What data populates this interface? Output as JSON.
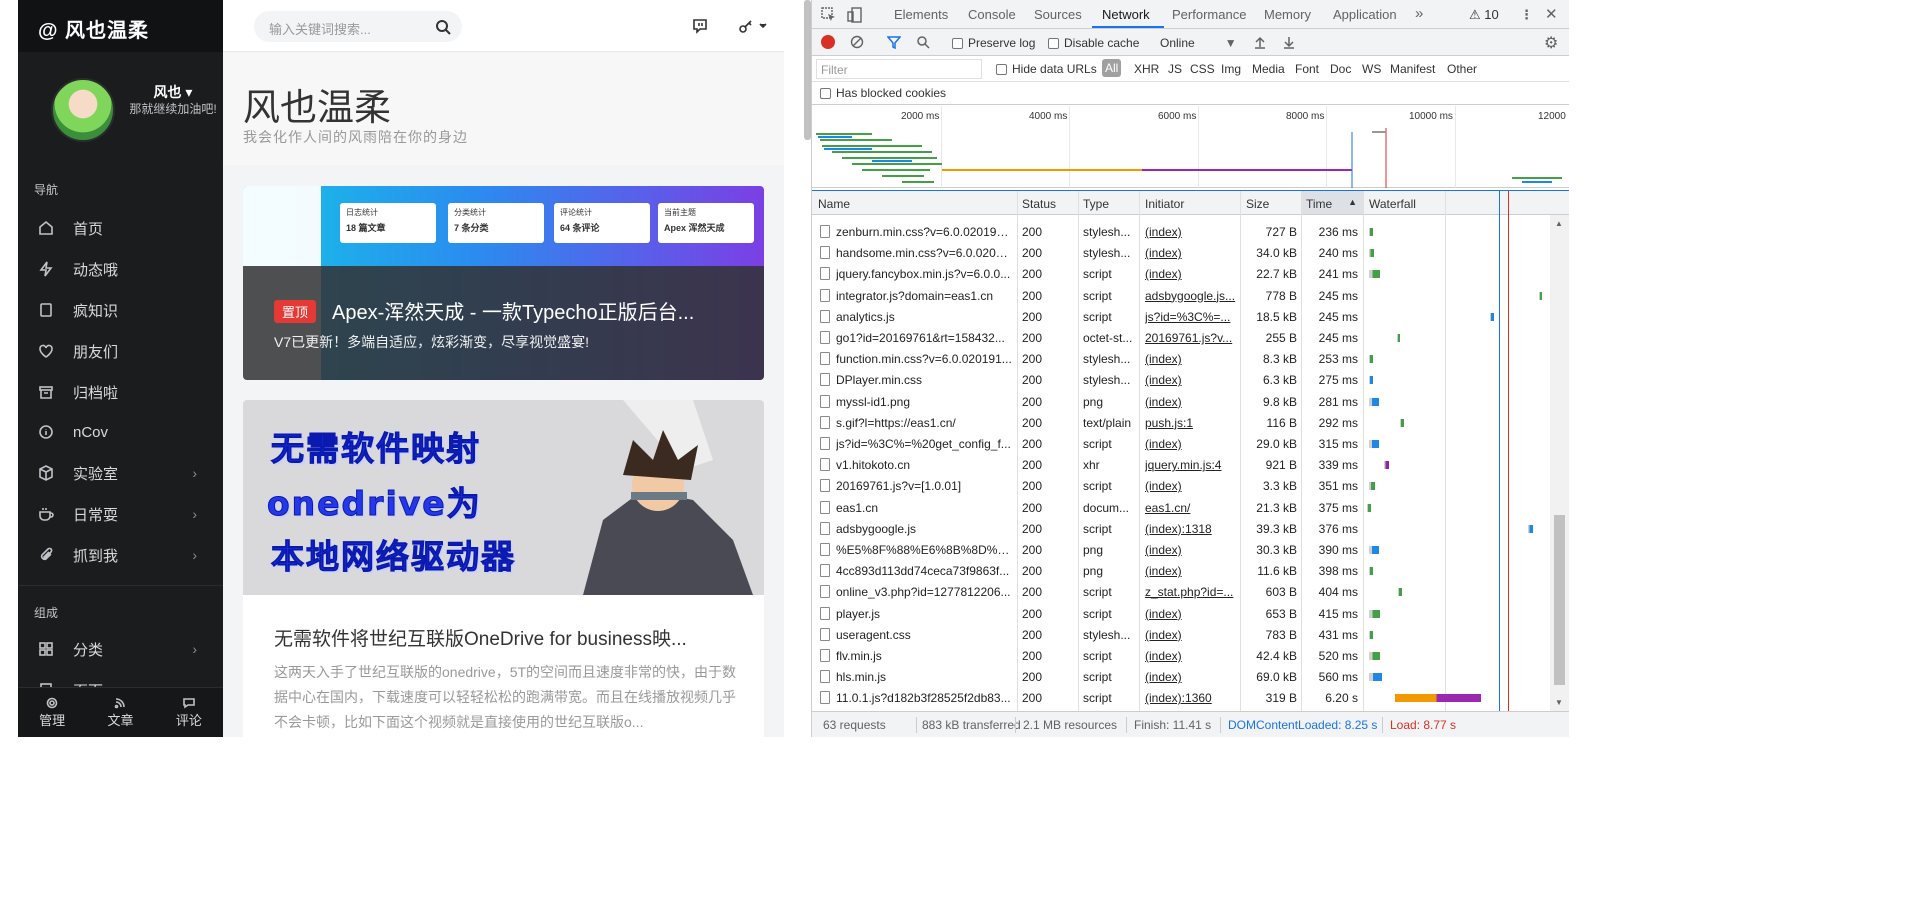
{
  "site": {
    "logo": "@ 风也温柔",
    "user": {
      "name": "风也 ▾",
      "motto": "那就继续加油吧!"
    },
    "nav_section": "导航",
    "nav": [
      "首页",
      "动态哦",
      "疯知识",
      "朋友们",
      "归档啦",
      "nCov",
      "实验室",
      "日常耍",
      "抓到我"
    ],
    "group_section": "组成",
    "group": [
      "分类",
      "页面"
    ],
    "footer": [
      "管理",
      "文章",
      "评论"
    ],
    "search_placeholder": "输入关键词搜索...",
    "hero_title": "风也温柔",
    "hero_subtitle": "我会化作人间的风雨陪在你的身边",
    "post1": {
      "pin": "置顶",
      "title": "Apex-浑然天成 - 一款Typecho正版后台...",
      "desc": "V7已更新！多端自适应，炫彩渐变，尽享视觉盛宴!",
      "stats": [
        "18 篇文章",
        "7 条分类",
        "64 条评论",
        "Apex 浑然天成"
      ]
    },
    "post2": {
      "banner": [
        "无需软件映射",
        "onedrive为",
        "本地网络驱动器"
      ],
      "title": "无需软件将世纪互联版OneDrive for business映...",
      "body": "这两天入手了世纪互联版的onedrive，5T的空间而且速度非常的快，由于数据中心在国内，下载速度可以轻轻松松的跑满带宽。而且在线播放视频几乎不会卡顿，比如下面这个视频就是直接使用的世纪互联版o..."
    }
  },
  "devtools": {
    "tabs": [
      "Elements",
      "Console",
      "Sources",
      "Network",
      "Performance",
      "Memory",
      "Application"
    ],
    "more": "»",
    "warnings": "⚠ 10",
    "preserve_log": "Preserve log",
    "disable_cache": "Disable cache",
    "throttle": "Online",
    "filter_placeholder": "Filter",
    "hide_data_urls": "Hide data URLs",
    "filter_types": [
      "All",
      "XHR",
      "JS",
      "CSS",
      "Img",
      "Media",
      "Font",
      "Doc",
      "WS",
      "Manifest",
      "Other"
    ],
    "has_blocked": "Has blocked cookies",
    "overview_ticks": [
      "2000 ms",
      "4000 ms",
      "6000 ms",
      "8000 ms",
      "10000 ms",
      "12000"
    ],
    "columns": [
      "Name",
      "Status",
      "Type",
      "Initiator",
      "Size",
      "Time",
      "Waterfall"
    ],
    "sort_arrow": "▲",
    "rows": [
      {
        "name": "zenburn.min.css?v=6.0.020191...",
        "status": "200",
        "type": "stylesh...",
        "initiator": "(index)",
        "size": "727 B",
        "time": "236 ms",
        "ws": 0.016,
        "we": 0.04,
        "c": "#43a047"
      },
      {
        "name": "handsome.min.css?v=6.0.0201...",
        "status": "200",
        "type": "stylesh...",
        "initiator": "(index)",
        "size": "34.0 kB",
        "time": "240 ms",
        "ws": 0.016,
        "we": 0.045,
        "c": "#43a047"
      },
      {
        "name": "jquery.fancybox.min.js?v=6.0.0...",
        "status": "200",
        "type": "script",
        "initiator": "(index)",
        "size": "22.7 kB",
        "time": "241 ms",
        "ws": 0.016,
        "we": 0.08,
        "c": "#43a047"
      },
      {
        "name": "integrator.js?domain=eas1.cn",
        "status": "200",
        "type": "script",
        "initiator": "adsbygoogle.js...",
        "size": "778 B",
        "time": "245 ms",
        "ws": 0.96,
        "we": 0.975,
        "c": "#43a047"
      },
      {
        "name": "analytics.js",
        "status": "200",
        "type": "script",
        "initiator": "js?id=%3C%=...",
        "size": "18.5 kB",
        "time": "245 ms",
        "ws": 0.69,
        "we": 0.71,
        "c": "#1e88e5"
      },
      {
        "name": "go1?id=20169761&rt=158432...",
        "status": "200",
        "type": "octet-st...",
        "initiator": "20169761.js?v...",
        "size": "255 B",
        "time": "245 ms",
        "ws": 0.17,
        "we": 0.19,
        "c": "#43a047"
      },
      {
        "name": "function.min.css?v=6.0.020191...",
        "status": "200",
        "type": "stylesh...",
        "initiator": "(index)",
        "size": "8.3 kB",
        "time": "253 ms",
        "ws": 0.016,
        "we": 0.04,
        "c": "#43a047"
      },
      {
        "name": "DPlayer.min.css",
        "status": "200",
        "type": "stylesh...",
        "initiator": "(index)",
        "size": "6.3 kB",
        "time": "275 ms",
        "ws": 0.016,
        "we": 0.04,
        "c": "#1e88e5"
      },
      {
        "name": "myssl-id1.png",
        "status": "200",
        "type": "png",
        "initiator": "(index)",
        "size": "9.8 kB",
        "time": "281 ms",
        "ws": 0.016,
        "we": 0.07,
        "c": "#1e88e5"
      },
      {
        "name": "s.gif?l=https://eas1.cn/",
        "status": "200",
        "type": "text/plain",
        "initiator": "push.js:1",
        "size": "116 B",
        "time": "292 ms",
        "ws": 0.19,
        "we": 0.21,
        "c": "#43a047"
      },
      {
        "name": "js?id=%3C%=%20get_config_f...",
        "status": "200",
        "type": "script",
        "initiator": "(index)",
        "size": "29.0 kB",
        "time": "315 ms",
        "ws": 0.016,
        "we": 0.07,
        "c": "#1e88e5"
      },
      {
        "name": "v1.hitokoto.cn",
        "status": "200",
        "type": "xhr",
        "initiator": "jquery.min.js:4",
        "size": "921 B",
        "time": "339 ms",
        "ws": 0.1,
        "we": 0.125,
        "c": "#8e24aa"
      },
      {
        "name": "20169761.js?v=[1.0.01]",
        "status": "200",
        "type": "script",
        "initiator": "(index)",
        "size": "3.3 kB",
        "time": "351 ms",
        "ws": 0.016,
        "we": 0.05,
        "c": "#43a047"
      },
      {
        "name": "eas1.cn",
        "status": "200",
        "type": "docum...",
        "initiator": "eas1.cn/",
        "size": "21.3 kB",
        "time": "375 ms",
        "ws": 0.005,
        "we": 0.03,
        "c": "#43a047"
      },
      {
        "name": "adsbygoogle.js",
        "status": "200",
        "type": "script",
        "initiator": "(index):1318",
        "size": "39.3 kB",
        "time": "376 ms",
        "ws": 0.9,
        "we": 0.925,
        "c": "#1e88e5"
      },
      {
        "name": "%E5%8F%88%E6%8B%8D%E4...",
        "status": "200",
        "type": "png",
        "initiator": "(index)",
        "size": "30.3 kB",
        "time": "390 ms",
        "ws": 0.016,
        "we": 0.07,
        "c": "#1e88e5"
      },
      {
        "name": "4cc893d113dd74ceca73f9863f...",
        "status": "200",
        "type": "png",
        "initiator": "(index)",
        "size": "11.6 kB",
        "time": "398 ms",
        "ws": 0.016,
        "we": 0.04,
        "c": "#43a047"
      },
      {
        "name": "online_v3.php?id=1277812206...",
        "status": "200",
        "type": "script",
        "initiator": "z_stat.php?id=...",
        "size": "603 B",
        "time": "404 ms",
        "ws": 0.18,
        "we": 0.2,
        "c": "#43a047"
      },
      {
        "name": "player.js",
        "status": "200",
        "type": "script",
        "initiator": "(index)",
        "size": "653 B",
        "time": "415 ms",
        "ws": 0.016,
        "we": 0.08,
        "c": "#43a047"
      },
      {
        "name": "useragent.css",
        "status": "200",
        "type": "stylesh...",
        "initiator": "(index)",
        "size": "783 B",
        "time": "431 ms",
        "ws": 0.016,
        "we": 0.04,
        "c": "#43a047"
      },
      {
        "name": "flv.min.js",
        "status": "200",
        "type": "script",
        "initiator": "(index)",
        "size": "42.4 kB",
        "time": "520 ms",
        "ws": 0.016,
        "we": 0.08,
        "c": "#43a047"
      },
      {
        "name": "hls.min.js",
        "status": "200",
        "type": "script",
        "initiator": "(index)",
        "size": "69.0 kB",
        "time": "560 ms",
        "ws": 0.016,
        "we": 0.09,
        "c": "#1e88e5"
      },
      {
        "name": "11.0.1.js?d182b3f28525f2db83...",
        "status": "200",
        "type": "script",
        "initiator": "(index):1360",
        "size": "319 B",
        "time": "6.20 s",
        "ws": 0.16,
        "we": 0.64,
        "c": "#9c27b0"
      }
    ],
    "status_bar": [
      "63 requests",
      "883 kB transferred",
      "2.1 MB resources",
      "Finish: 11.41 s",
      "DOMContentLoaded: 8.25 s",
      "Load: 8.77 s"
    ],
    "colors": {
      "dom": "#1a73e8",
      "load": "#d93025"
    }
  }
}
